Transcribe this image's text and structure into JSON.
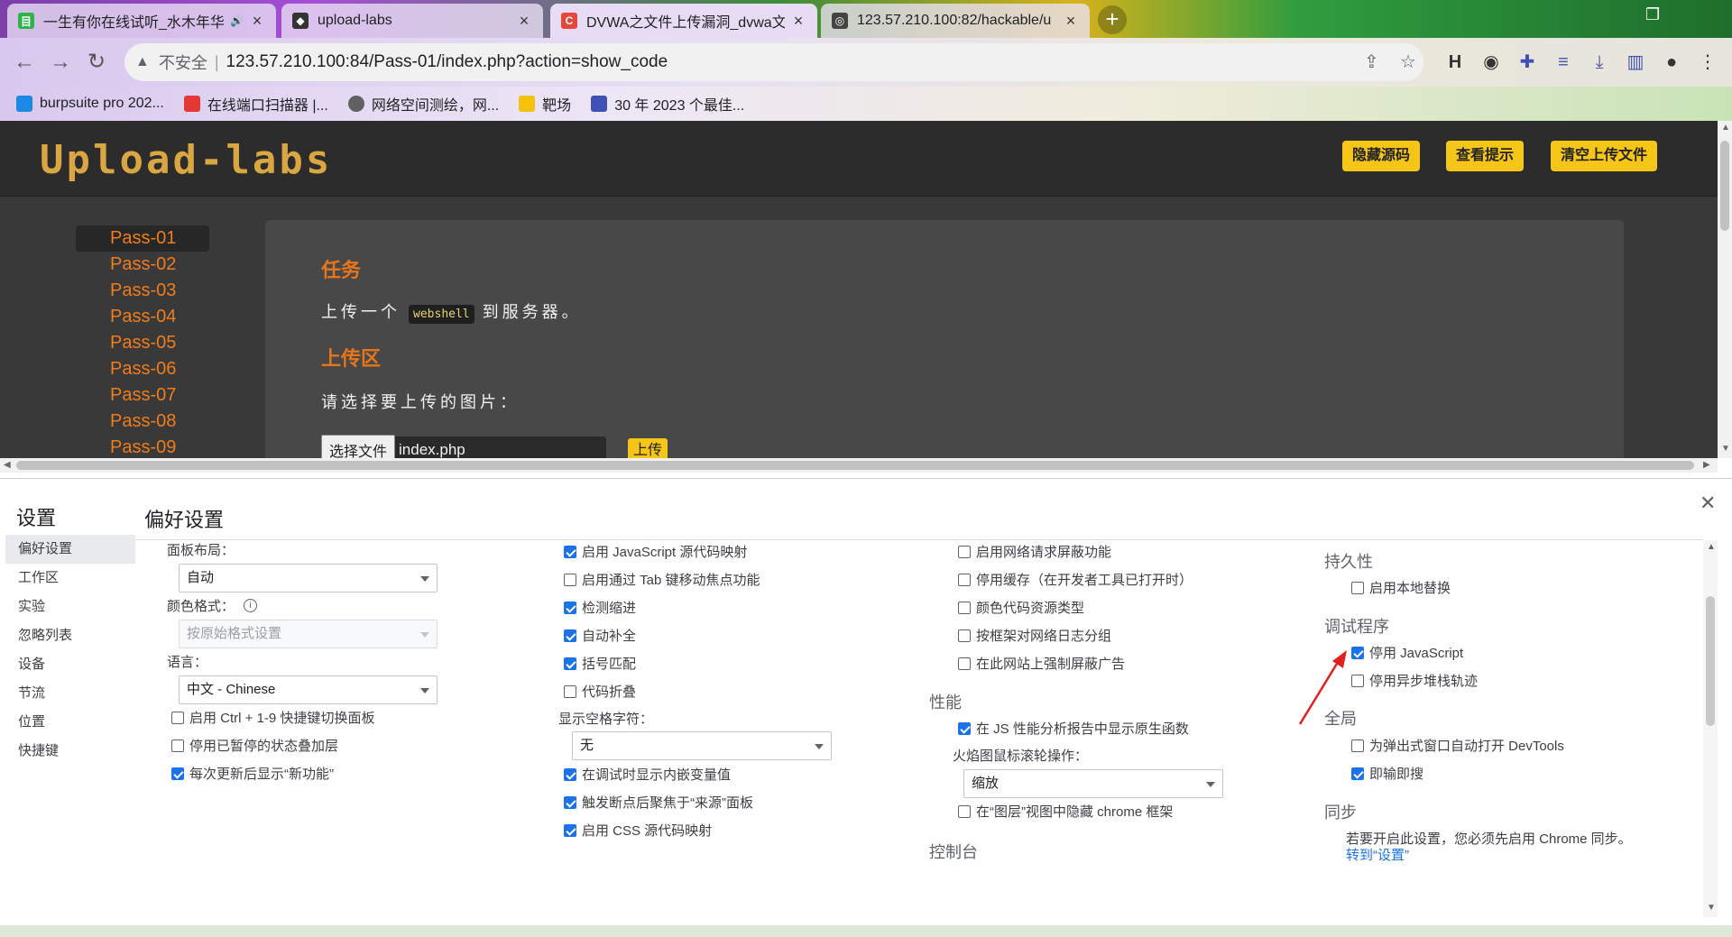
{
  "tabs": [
    {
      "title": "一生有你在线试听_水木年华",
      "favicon_color": "#2db34a",
      "favicon_text": "目",
      "audio": true
    },
    {
      "title": "upload-labs",
      "favicon_color": "#333333",
      "favicon_text": "◆"
    },
    {
      "title": "DVWA之文件上传漏洞_dvwa文",
      "favicon_color": "#e5473c",
      "favicon_text": "C"
    },
    {
      "title": "123.57.210.100:82/hackable/u",
      "favicon_color": "#444444",
      "favicon_text": "◎"
    }
  ],
  "omnibox": {
    "security": "不安全",
    "url": "123.57.210.100:84/Pass-01/index.php?action=show_code"
  },
  "bookmarks": [
    {
      "label": "burpsuite pro 202...",
      "color": "#1e88e5"
    },
    {
      "label": "在线端口扫描器 |...",
      "color": "#e53935"
    },
    {
      "label": "网络空间测绘，网...",
      "color": "#616161"
    },
    {
      "label": "靶场",
      "color": "#f4c20d"
    },
    {
      "label": "30 年 2023 个最佳...",
      "color": "#3f51b5"
    }
  ],
  "site": {
    "logo": "Upload-labs",
    "header_buttons": [
      "隐藏源码",
      "查看提示",
      "清空上传文件"
    ],
    "passes": [
      "Pass-01",
      "Pass-02",
      "Pass-03",
      "Pass-04",
      "Pass-05",
      "Pass-06",
      "Pass-07",
      "Pass-08",
      "Pass-09"
    ],
    "task_heading": "任务",
    "task_prefix": "上传一个",
    "task_code": "webshell",
    "task_suffix": "到服务器。",
    "upload_heading": "上传区",
    "upload_prompt": "请选择要上传的图片：",
    "file_button": "选择文件",
    "file_name": "index.php",
    "upload_button": "上传"
  },
  "devtools": {
    "settings_title": "设置",
    "pref_title": "偏好设置",
    "sidebar": [
      "偏好设置",
      "工作区",
      "实验",
      "忽略列表",
      "设备",
      "节流",
      "位置",
      "快捷键"
    ],
    "col1": {
      "panel_layout_label": "面板布局：",
      "panel_layout_value": "自动",
      "color_format_label": "颜色格式：",
      "color_format_value": "按原始格式设置",
      "language_label": "语言：",
      "language_value": "中文 - Chinese",
      "checks": [
        {
          "label": "启用 Ctrl + 1-9 快捷键切换面板",
          "checked": false
        },
        {
          "label": "停用已暂停的状态叠加层",
          "checked": false
        },
        {
          "label": "每次更新后显示“新功能”",
          "checked": true
        }
      ]
    },
    "col2": {
      "checks_top": [
        {
          "label": "启用 JavaScript 源代码映射",
          "checked": true
        },
        {
          "label": "启用通过 Tab 键移动焦点功能",
          "checked": false
        },
        {
          "label": "检测缩进",
          "checked": true
        },
        {
          "label": "自动补全",
          "checked": true
        },
        {
          "label": "括号匹配",
          "checked": true
        },
        {
          "label": "代码折叠",
          "checked": false
        }
      ],
      "whitespace_label": "显示空格字符：",
      "whitespace_value": "无",
      "checks_bottom": [
        {
          "label": "在调试时显示内嵌变量值",
          "checked": true
        },
        {
          "label": "触发断点后聚焦于“来源”面板",
          "checked": true
        },
        {
          "label": "启用 CSS 源代码映射",
          "checked": true
        }
      ]
    },
    "col3": {
      "checks_top": [
        {
          "label": "启用网络请求屏蔽功能",
          "checked": false
        },
        {
          "label": "停用缓存（在开发者工具已打开时）",
          "checked": false
        },
        {
          "label": "颜色代码资源类型",
          "checked": false
        },
        {
          "label": "按框架对网络日志分组",
          "checked": false
        },
        {
          "label": "在此网站上强制屏蔽广告",
          "checked": false
        }
      ],
      "perf_section": "性能",
      "perf_check": {
        "label": "在 JS 性能分析报告中显示原生函数",
        "checked": true
      },
      "flame_label": "火焰图鼠标滚轮操作：",
      "flame_value": "缩放",
      "layers_check": {
        "label": "在“图层”视图中隐藏 chrome 框架",
        "checked": false
      },
      "console_section": "控制台"
    },
    "col4": {
      "persistence_section": "持久性",
      "persistence_check": {
        "label": "启用本地替换",
        "checked": false
      },
      "debugger_section": "调试程序",
      "debugger_checks": [
        {
          "label": "停用 JavaScript",
          "checked": true
        },
        {
          "label": "停用异步堆栈轨迹",
          "checked": false
        }
      ],
      "global_section": "全局",
      "global_checks": [
        {
          "label": "为弹出式窗口自动打开 DevTools",
          "checked": false
        },
        {
          "label": "即输即搜",
          "checked": true
        }
      ],
      "sync_section": "同步",
      "sync_text": "若要开启此设置，您必须先启用 Chrome 同步。",
      "sync_link": "转到“设置”"
    }
  }
}
